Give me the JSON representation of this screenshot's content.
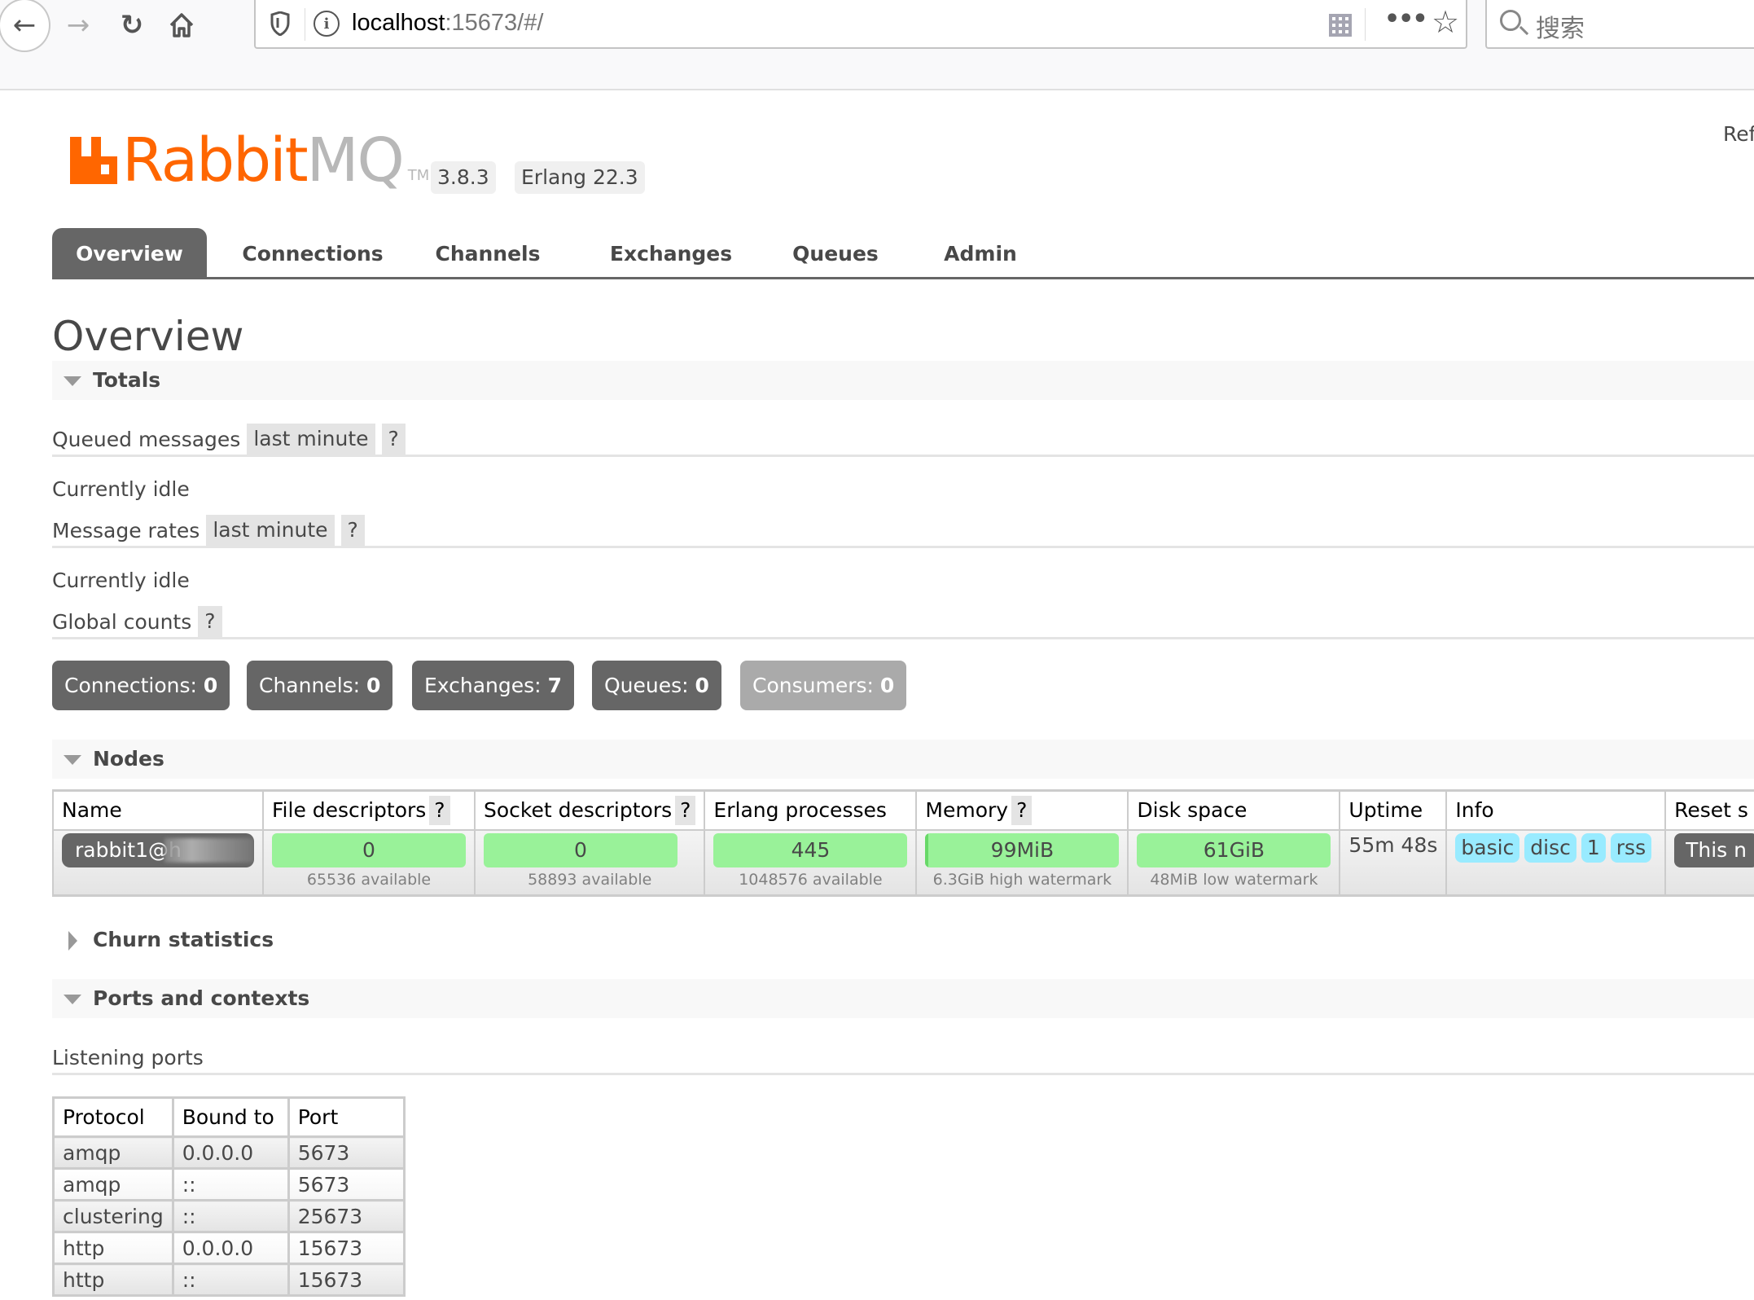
{
  "browser": {
    "url_host": "localhost",
    "url_rest": ":15673/#/",
    "search_placeholder": "搜索"
  },
  "header": {
    "logo_part1": "Rabbit",
    "logo_part2": "MQ",
    "logo_tm": "TM",
    "version": "3.8.3",
    "erlang": "Erlang 22.3",
    "refreshed_partial": "Ref"
  },
  "tabs": [
    {
      "label": "Overview",
      "active": true
    },
    {
      "label": "Connections"
    },
    {
      "label": "Channels"
    },
    {
      "label": "Exchanges"
    },
    {
      "label": "Queues"
    },
    {
      "label": "Admin"
    }
  ],
  "page_title": "Overview",
  "totals": {
    "title": "Totals",
    "queued_label": "Queued messages",
    "queued_range": "last minute",
    "help": "?",
    "queued_status": "Currently idle",
    "rates_label": "Message rates",
    "rates_range": "last minute",
    "rates_status": "Currently idle",
    "global_label": "Global counts",
    "counts": [
      {
        "label": "Connections: ",
        "value": "0",
        "enabled": true
      },
      {
        "label": "Channels: ",
        "value": "0",
        "enabled": true
      },
      {
        "label": "Exchanges: ",
        "value": "7",
        "enabled": true
      },
      {
        "label": "Queues: ",
        "value": "0",
        "enabled": true
      },
      {
        "label": "Consumers: ",
        "value": "0",
        "enabled": false
      }
    ]
  },
  "nodes": {
    "title": "Nodes",
    "columns": [
      "Name",
      "File descriptors",
      "Socket descriptors",
      "Erlang processes",
      "Memory",
      "Disk space",
      "Uptime",
      "Info",
      "Reset s"
    ],
    "row": {
      "name": "rabbit1@h",
      "file_descriptors": {
        "value": "0",
        "sub": "65536 available"
      },
      "socket_descriptors": {
        "value": "0",
        "sub": "58893 available"
      },
      "erlang_processes": {
        "value": "445",
        "sub": "1048576 available"
      },
      "memory": {
        "value": "99MiB",
        "sub": "6.3GiB high watermark",
        "used_fraction": 0.015
      },
      "disk": {
        "value": "61GiB",
        "sub": "48MiB low watermark"
      },
      "uptime": "55m 48s",
      "info_tags": [
        "basic",
        "disc",
        "1",
        "rss"
      ],
      "reset": "This n"
    }
  },
  "churn": {
    "title": "Churn statistics"
  },
  "ports": {
    "title": "Ports and contexts",
    "listening_label": "Listening ports",
    "columns": [
      "Protocol",
      "Bound to",
      "Port"
    ],
    "rows": [
      [
        "amqp",
        "0.0.0.0",
        "5673"
      ],
      [
        "amqp",
        "::",
        "5673"
      ],
      [
        "clustering",
        "::",
        "25673"
      ],
      [
        "http",
        "0.0.0.0",
        "15673"
      ],
      [
        "http",
        "::",
        "15673"
      ]
    ]
  },
  "colors": {
    "brand_orange": "#ff6600",
    "tab_active": "#666666",
    "bar_green": "#99f299",
    "info_blue": "#99ebff"
  }
}
